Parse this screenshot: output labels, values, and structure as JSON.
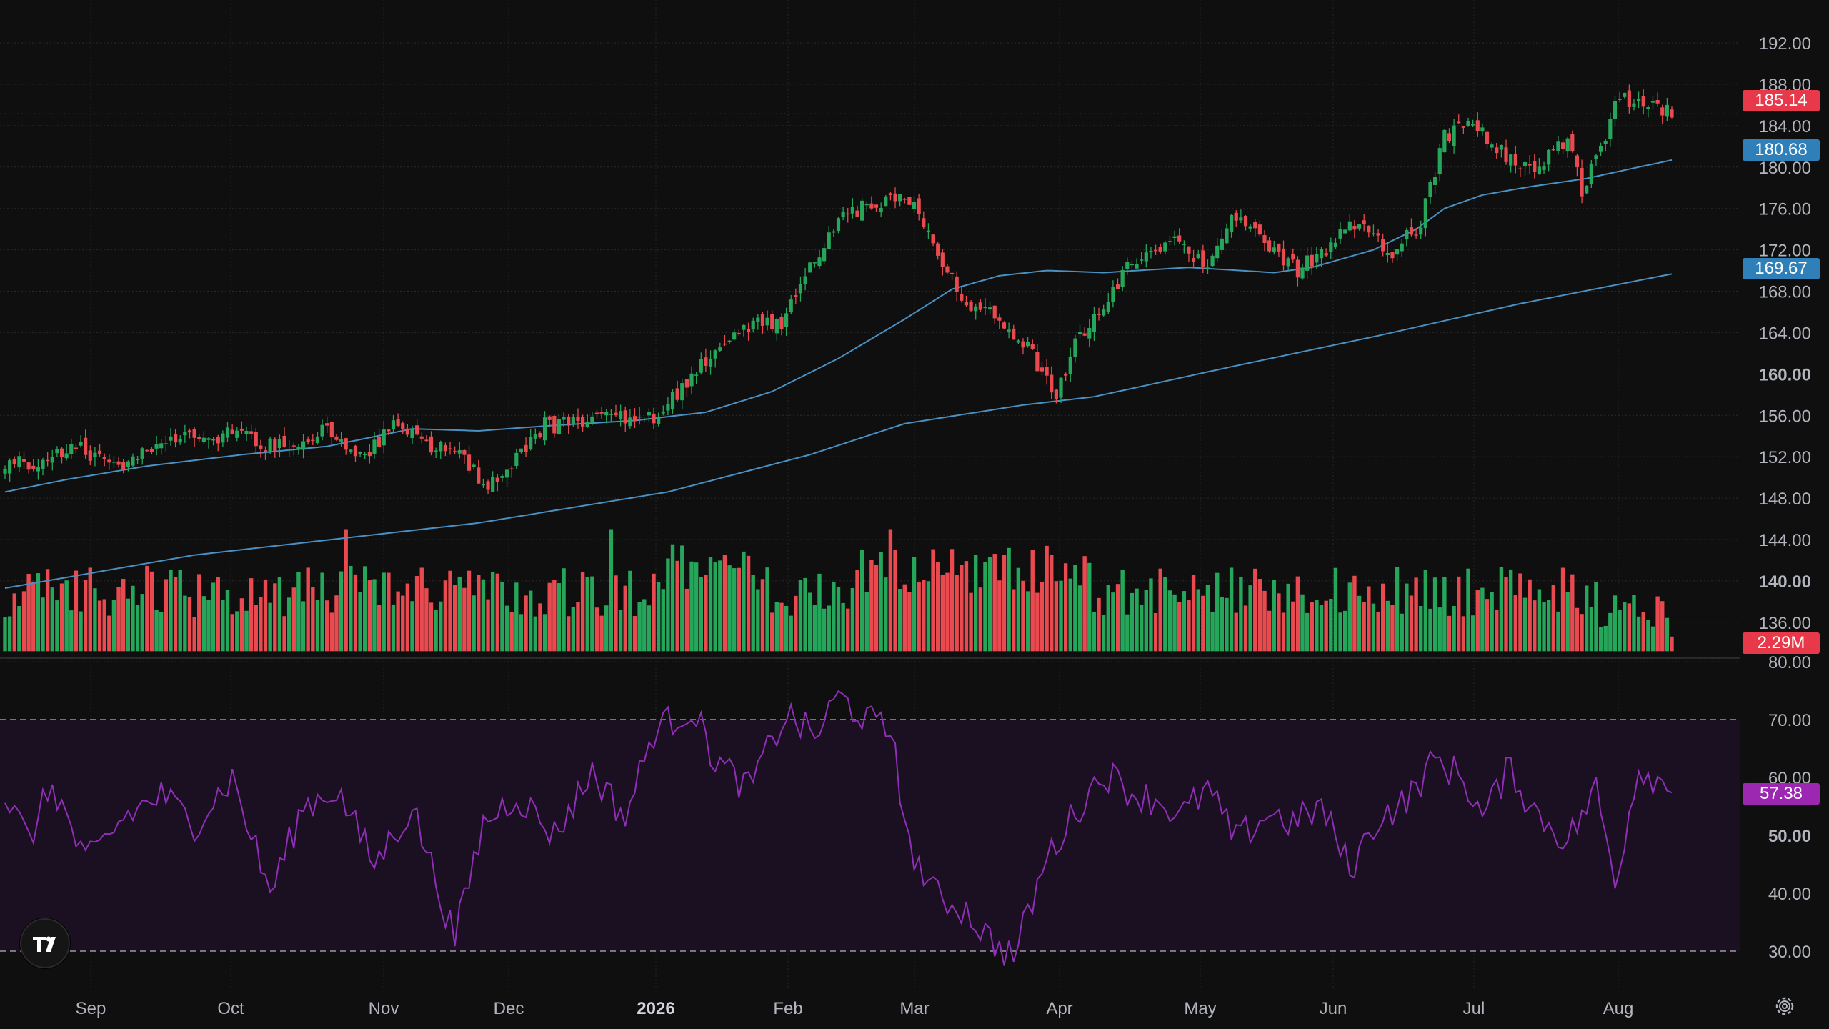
{
  "chart_data": {
    "type": "candlestick",
    "price_axis": {
      "ticks": [
        "192.00",
        "188.00",
        "184.00",
        "180.00",
        "176.00",
        "172.00",
        "168.00",
        "164.00",
        "160.00",
        "156.00",
        "152.00",
        "148.00",
        "144.00",
        "140.00",
        "136.00"
      ],
      "range": [
        133.5,
        193.8
      ]
    },
    "rsi_axis": {
      "ticks": [
        "80.00",
        "70.00",
        "60.00",
        "50.00",
        "40.00",
        "30.00"
      ],
      "upper_band": 70,
      "lower_band": 30
    },
    "time_axis": {
      "labels": [
        "Sep",
        "Oct",
        "Nov",
        "Dec",
        "2026",
        "Feb",
        "Mar",
        "Apr",
        "May",
        "Jun",
        "Jul",
        "Aug"
      ],
      "bold_label": "2026"
    },
    "price_anchors": [
      [
        0,
        151.5
      ],
      [
        8,
        151
      ],
      [
        14,
        153
      ],
      [
        20,
        152
      ],
      [
        25,
        151
      ],
      [
        31,
        153
      ],
      [
        38,
        154.2
      ],
      [
        44,
        153.8
      ],
      [
        50,
        154.5
      ],
      [
        56,
        153
      ],
      [
        62,
        153.5
      ],
      [
        68,
        155
      ],
      [
        75,
        152
      ],
      [
        82,
        155
      ],
      [
        88,
        153.5
      ],
      [
        96,
        152
      ],
      [
        102,
        149
      ],
      [
        107,
        151.5
      ],
      [
        114,
        155
      ],
      [
        121,
        155.2
      ],
      [
        128,
        155.8
      ],
      [
        137,
        156
      ],
      [
        143,
        158.5
      ],
      [
        150,
        162.5
      ],
      [
        156,
        164.5
      ],
      [
        164,
        165
      ],
      [
        170,
        170
      ],
      [
        176,
        175
      ],
      [
        183,
        176.5
      ],
      [
        190,
        177
      ],
      [
        192,
        176
      ],
      [
        197,
        171.5
      ],
      [
        204,
        166
      ],
      [
        210,
        165.5
      ],
      [
        216,
        162.5
      ],
      [
        222,
        158
      ],
      [
        226,
        163
      ],
      [
        228,
        164
      ],
      [
        238,
        171
      ],
      [
        246,
        173
      ],
      [
        254,
        170.5
      ],
      [
        260,
        175.5
      ],
      [
        266,
        173
      ],
      [
        273,
        170
      ],
      [
        280,
        172.5
      ],
      [
        286,
        175
      ],
      [
        292,
        171.5
      ],
      [
        299,
        174.5
      ],
      [
        304,
        183
      ],
      [
        310,
        184.5
      ],
      [
        318,
        180.5
      ],
      [
        323,
        179.5
      ],
      [
        330,
        183
      ],
      [
        333,
        177.5
      ],
      [
        336,
        181
      ],
      [
        341,
        186.8
      ],
      [
        347,
        186
      ],
      [
        352,
        185.1
      ]
    ],
    "ma_short": {
      "color": "#4a90c2",
      "last": "180.68",
      "anchors": [
        [
          0,
          148.6
        ],
        [
          13,
          149.8
        ],
        [
          30,
          151.1
        ],
        [
          50,
          152.2
        ],
        [
          68,
          153
        ],
        [
          86,
          154.7
        ],
        [
          100,
          154.5
        ],
        [
          115,
          155
        ],
        [
          133,
          155.5
        ],
        [
          148,
          156.3
        ],
        [
          162,
          158.3
        ],
        [
          176,
          161.5
        ],
        [
          190,
          165.3
        ],
        [
          200,
          168.2
        ],
        [
          210,
          169.5
        ],
        [
          220,
          170
        ],
        [
          232,
          169.8
        ],
        [
          250,
          170.3
        ],
        [
          268,
          169.8
        ],
        [
          276,
          170.3
        ],
        [
          289,
          172
        ],
        [
          298,
          174
        ],
        [
          304,
          176
        ],
        [
          312,
          177.3
        ],
        [
          322,
          178.1
        ],
        [
          334,
          178.9
        ],
        [
          345,
          180
        ],
        [
          352,
          180.68
        ]
      ]
    },
    "ma_long": {
      "color": "#4a90c2",
      "last": "169.67",
      "anchors": [
        [
          0,
          139.3
        ],
        [
          40,
          142.5
        ],
        [
          100,
          145.6
        ],
        [
          140,
          148.6
        ],
        [
          170,
          152.2
        ],
        [
          190,
          155.2
        ],
        [
          215,
          157
        ],
        [
          230,
          157.8
        ],
        [
          260,
          160.8
        ],
        [
          290,
          163.7
        ],
        [
          320,
          166.8
        ],
        [
          352,
          169.67
        ]
      ]
    },
    "volume": {
      "last_label": "2.29M",
      "baseline_price": 133.2,
      "max_price": 145.0
    },
    "rsi": {
      "last": "57.38",
      "anchors": [
        [
          0,
          57
        ],
        [
          5,
          49
        ],
        [
          10,
          59
        ],
        [
          17,
          45
        ],
        [
          25,
          53
        ],
        [
          33,
          57
        ],
        [
          40,
          52
        ],
        [
          48,
          60
        ],
        [
          56,
          40
        ],
        [
          63,
          55
        ],
        [
          70,
          58
        ],
        [
          78,
          45
        ],
        [
          86,
          55
        ],
        [
          95,
          32
        ],
        [
          101,
          52
        ],
        [
          108,
          57
        ],
        [
          116,
          50
        ],
        [
          124,
          61
        ],
        [
          131,
          53
        ],
        [
          137,
          68
        ],
        [
          145,
          72
        ],
        [
          150,
          63
        ],
        [
          157,
          58
        ],
        [
          165,
          71
        ],
        [
          171,
          67
        ],
        [
          176,
          74
        ],
        [
          182,
          70
        ],
        [
          188,
          67
        ],
        [
          190,
          50
        ],
        [
          196,
          40
        ],
        [
          203,
          37
        ],
        [
          208,
          32
        ],
        [
          213,
          29
        ],
        [
          220,
          46
        ],
        [
          226,
          54
        ],
        [
          232,
          61
        ],
        [
          239,
          57
        ],
        [
          244,
          56
        ],
        [
          248,
          53
        ],
        [
          254,
          58
        ],
        [
          260,
          49
        ],
        [
          267,
          54
        ],
        [
          272,
          52
        ],
        [
          278,
          55
        ],
        [
          284,
          44
        ],
        [
          290,
          53
        ],
        [
          296,
          56
        ],
        [
          302,
          63
        ],
        [
          308,
          60
        ],
        [
          312,
          53
        ],
        [
          318,
          62
        ],
        [
          322,
          55
        ],
        [
          330,
          49
        ],
        [
          336,
          58
        ],
        [
          340,
          42
        ],
        [
          345,
          62
        ],
        [
          350,
          59
        ],
        [
          352,
          57.38
        ]
      ]
    }
  },
  "labels": {
    "last_price": "185.14",
    "ma_short_value": "180.68",
    "ma_long_value": "169.67",
    "volume_value": "2.29M",
    "rsi_value": "57.38"
  },
  "colors": {
    "background": "#0f0f0f",
    "up": "#26a65b",
    "down": "#e84a4f",
    "ma": "#4a90c2",
    "rsi_line": "#8e2fb5",
    "rsi_band": "#1b0f22",
    "price_badge": "#e8394a",
    "ma_badge": "#2f7fb9",
    "volume_badge": "#e8394a",
    "rsi_badge": "#9c27b0",
    "axis_text": "#b2b5be"
  },
  "icons": {
    "logo": "tradingview-logo-icon",
    "settings": "gear-icon"
  }
}
